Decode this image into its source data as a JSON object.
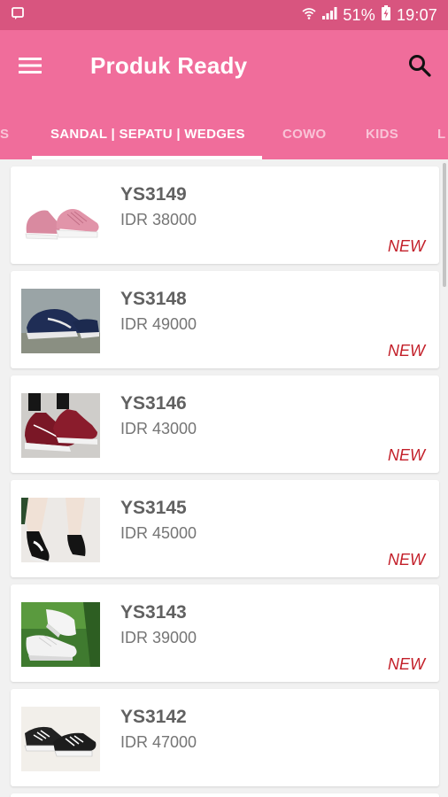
{
  "status_bar": {
    "battery": "51%",
    "time": "19:07"
  },
  "app_bar": {
    "title": "Produk Ready",
    "menu_icon": "menu-icon",
    "search_icon": "search-icon"
  },
  "tabs": [
    {
      "label": "S"
    },
    {
      "label": "SANDAL | SEPATU | WEDGES"
    },
    {
      "label": "COWO"
    },
    {
      "label": "KIDS"
    },
    {
      "label": "L"
    }
  ],
  "products": [
    {
      "code": "YS3149",
      "price": "IDR 38000",
      "badge": "NEW"
    },
    {
      "code": "YS3148",
      "price": "IDR 49000",
      "badge": "NEW"
    },
    {
      "code": "YS3146",
      "price": "IDR 43000",
      "badge": "NEW"
    },
    {
      "code": "YS3145",
      "price": "IDR 45000",
      "badge": "NEW"
    },
    {
      "code": "YS3143",
      "price": "IDR 39000",
      "badge": "NEW"
    },
    {
      "code": "YS3142",
      "price": "IDR 47000",
      "badge": ""
    }
  ],
  "colors": {
    "status_bar": "#d8557f",
    "app_bar": "#f06d9b",
    "badge": "#c3202a"
  }
}
